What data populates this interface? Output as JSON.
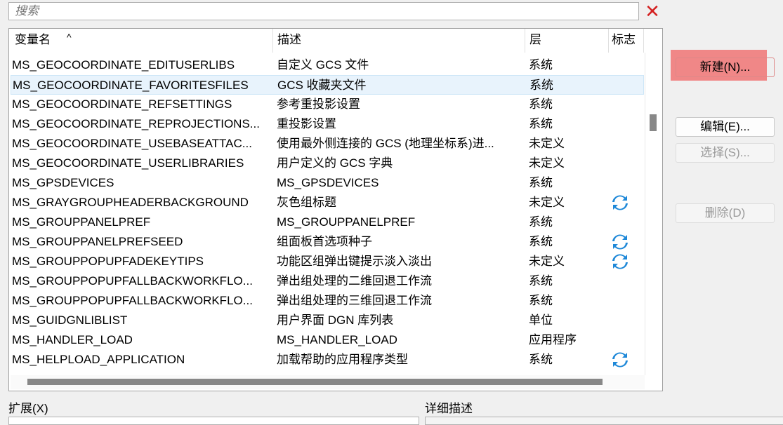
{
  "search": {
    "placeholder": "搜索"
  },
  "columns": [
    "变量名",
    "描述",
    "层",
    "标志"
  ],
  "sort_indicator": "^",
  "rows": [
    {
      "name": "MS_GEOCOORDINATE_EDITUSERLIBS",
      "desc": "自定义 GCS 文件",
      "layer": "系统",
      "flag": false
    },
    {
      "name": "MS_GEOCOORDINATE_FAVORITESFILES",
      "desc": "GCS 收藏夹文件",
      "layer": "系统",
      "flag": false,
      "selected": true
    },
    {
      "name": "MS_GEOCOORDINATE_REFSETTINGS",
      "desc": "参考重投影设置",
      "layer": "系统",
      "flag": false
    },
    {
      "name": "MS_GEOCOORDINATE_REPROJECTIONS...",
      "desc": "重投影设置",
      "layer": "系统",
      "flag": false
    },
    {
      "name": "MS_GEOCOORDINATE_USEBASEATTAC...",
      "desc": "使用最外侧连接的 GCS (地理坐标系)进...",
      "layer": "未定义",
      "flag": false
    },
    {
      "name": "MS_GEOCOORDINATE_USERLIBRARIES",
      "desc": "用户定义的 GCS 字典",
      "layer": "未定义",
      "flag": false
    },
    {
      "name": "MS_GPSDEVICES",
      "desc": "MS_GPSDEVICES",
      "layer": "系统",
      "flag": false
    },
    {
      "name": "MS_GRAYGROUPHEADERBACKGROUND",
      "desc": "灰色组标题",
      "layer": "未定义",
      "flag": true
    },
    {
      "name": "MS_GROUPPANELPREF",
      "desc": "MS_GROUPPANELPREF",
      "layer": "系统",
      "flag": false
    },
    {
      "name": "MS_GROUPPANELPREFSEED",
      "desc": "组面板首选项种子",
      "layer": "系统",
      "flag": true
    },
    {
      "name": "MS_GROUPPOPUPFADEKEYTIPS",
      "desc": "功能区组弹出键提示淡入淡出",
      "layer": "未定义",
      "flag": true
    },
    {
      "name": "MS_GROUPPOPUPFALLBACKWORKFLO...",
      "desc": "弹出组处理的二维回退工作流",
      "layer": "系统",
      "flag": false
    },
    {
      "name": "MS_GROUPPOPUPFALLBACKWORKFLO...",
      "desc": "弹出组处理的三维回退工作流",
      "layer": "系统",
      "flag": false
    },
    {
      "name": "MS_GUIDGNLIBLIST",
      "desc": "用户界面 DGN 库列表",
      "layer": "单位",
      "flag": false
    },
    {
      "name": "MS_HANDLER_LOAD",
      "desc": "MS_HANDLER_LOAD",
      "layer": "应用程序",
      "flag": false
    },
    {
      "name": "MS_HELPLOAD_APPLICATION",
      "desc": "加载帮助的应用程序类型",
      "layer": "系统",
      "flag": true
    }
  ],
  "buttons": {
    "new": "新建(N)...",
    "edit": "编辑(E)...",
    "select": "选择(S)...",
    "delete": "删除(D)"
  },
  "bottom": {
    "expand_label": "扩展(X)",
    "detail_label": "详细描述"
  },
  "colors": {
    "highlight": "#f07070",
    "selected_row": "#e8f3fc",
    "clear": "#d42020",
    "sync": "#1e88d8"
  }
}
